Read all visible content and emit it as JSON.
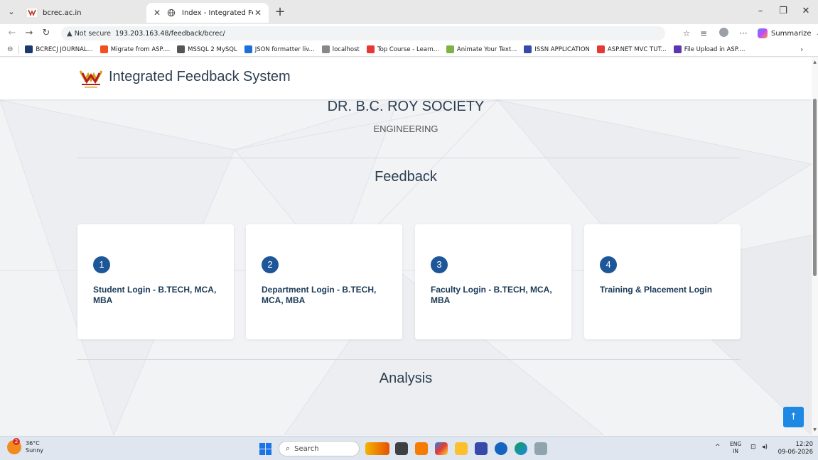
{
  "browser": {
    "tabs": [
      {
        "title": "bcrec.ac.in",
        "favicon": "bcrec-favicon-icon"
      },
      {
        "title": "Index - Integrated Feedback Syste",
        "favicon": "globe-icon"
      }
    ],
    "address": {
      "security_label": "Not secure",
      "url": "193.203.163.48/feedback/bcrec/"
    },
    "summarize_label": "Summarize",
    "bookmarks": [
      {
        "label": "BCRECJ JOURNAL...",
        "color": "#1a3a6b"
      },
      {
        "label": "Migrate from ASP....",
        "color": "#f25022"
      },
      {
        "label": "MSSQL 2 MySQL",
        "color": "#555555"
      },
      {
        "label": "JSON formatter liv...",
        "color": "#1e6fd9"
      },
      {
        "label": "localhost",
        "color": "#888888"
      },
      {
        "label": "Top Course - Learn...",
        "color": "#e53935"
      },
      {
        "label": "Animate Your Text...",
        "color": "#7cb342"
      },
      {
        "label": "ISSN APPLICATION",
        "color": "#3949ab"
      },
      {
        "label": "ASP.NET MVC TUT...",
        "color": "#e53935"
      },
      {
        "label": "File Upload in ASP....",
        "color": "#5e35b1"
      }
    ]
  },
  "site": {
    "title": "Integrated Feedback System",
    "society": "DR. B.C. ROY SOCIETY",
    "subtitle": "ENGINEERING",
    "feedback_heading": "Feedback",
    "analysis_heading": "Analysis",
    "cards": [
      {
        "number": "1",
        "label": "Student Login - B.TECH, MCA, MBA"
      },
      {
        "number": "2",
        "label": "Department Login - B.TECH, MCA, MBA"
      },
      {
        "number": "3",
        "label": "Faculty Login - B.TECH, MCA, MBA"
      },
      {
        "number": "4",
        "label": "Training & Placement Login"
      }
    ],
    "back_to_top": "↑",
    "accent_color": "#1e5799"
  },
  "taskbar": {
    "weather_temp": "36°C",
    "weather_desc": "Sunny",
    "notification_count": "2",
    "search_label": "Search",
    "lang_top": "ENG",
    "lang_bottom": "IN",
    "time": "12:20",
    "date": "09-06-2026"
  }
}
